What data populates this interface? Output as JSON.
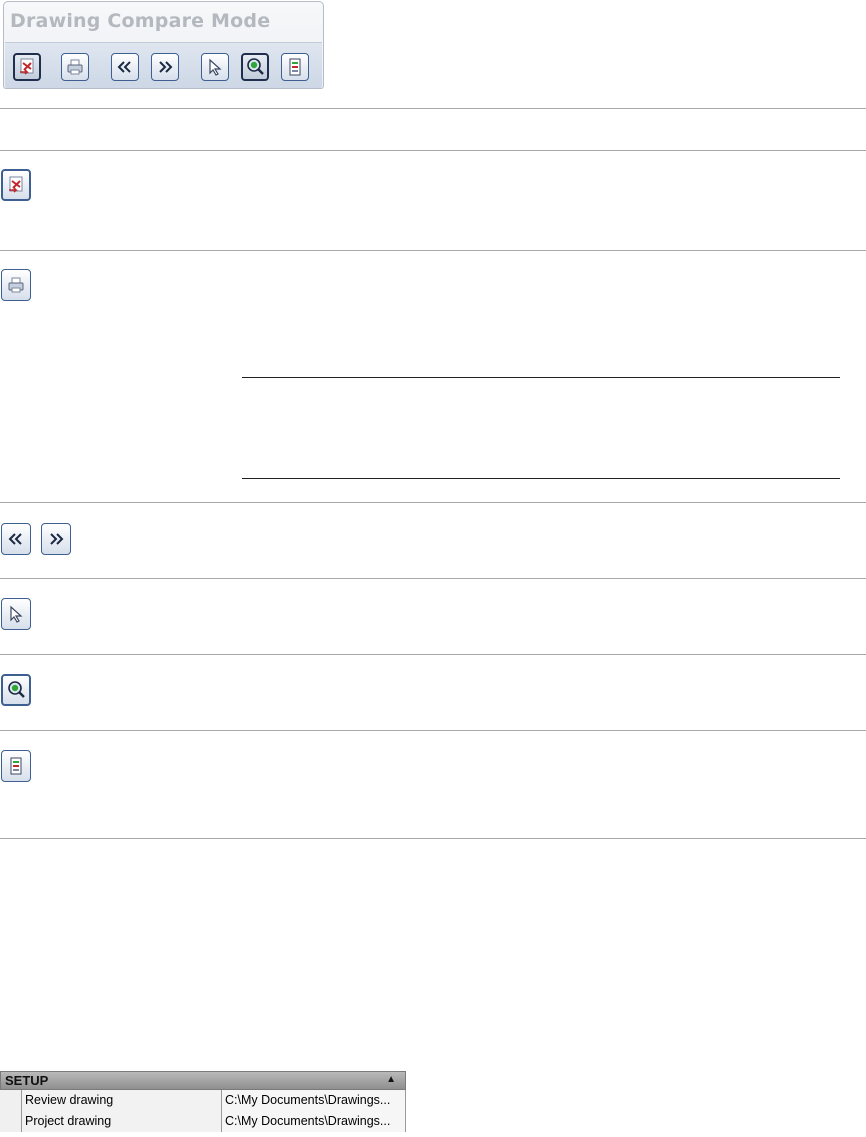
{
  "toolbar": {
    "title": "Drawing Compare Mode",
    "buttons": [
      {
        "name": "exit-compare-mode",
        "icon": "exit-compare-icon",
        "active": true
      },
      {
        "name": "print",
        "icon": "print-icon",
        "active": false
      },
      {
        "name": "previous-change",
        "icon": "previous-icon",
        "active": false
      },
      {
        "name": "next-change",
        "icon": "next-icon",
        "active": false
      },
      {
        "name": "select",
        "icon": "select-cursor-icon",
        "active": false
      },
      {
        "name": "zoom-to-change",
        "icon": "zoom-change-icon",
        "active": true
      },
      {
        "name": "compare-settings",
        "icon": "settings-panel-icon",
        "active": false
      }
    ]
  },
  "rows": [
    {
      "icons": [
        "exit-compare-icon"
      ]
    },
    {
      "icons": [
        "print-icon"
      ]
    },
    {
      "icons": [
        "previous-icon",
        "next-icon"
      ]
    },
    {
      "icons": [
        "select-cursor-icon"
      ]
    },
    {
      "icons": [
        "zoom-change-icon"
      ]
    },
    {
      "icons": [
        "settings-panel-icon"
      ]
    }
  ],
  "setup": {
    "title": "SETUP",
    "collapse_icon": "collapse-up-icon",
    "properties": [
      {
        "label": "Review drawing",
        "value": "C:\\My Documents\\Drawings..."
      },
      {
        "label": "Project drawing",
        "value": "C:\\My Documents\\Drawings..."
      }
    ]
  },
  "colors": {
    "button_border": "#3e5f91",
    "accent_red": "#c0282d",
    "accent_green": "#2fa53a",
    "header_gray": "#a6a6a6"
  }
}
